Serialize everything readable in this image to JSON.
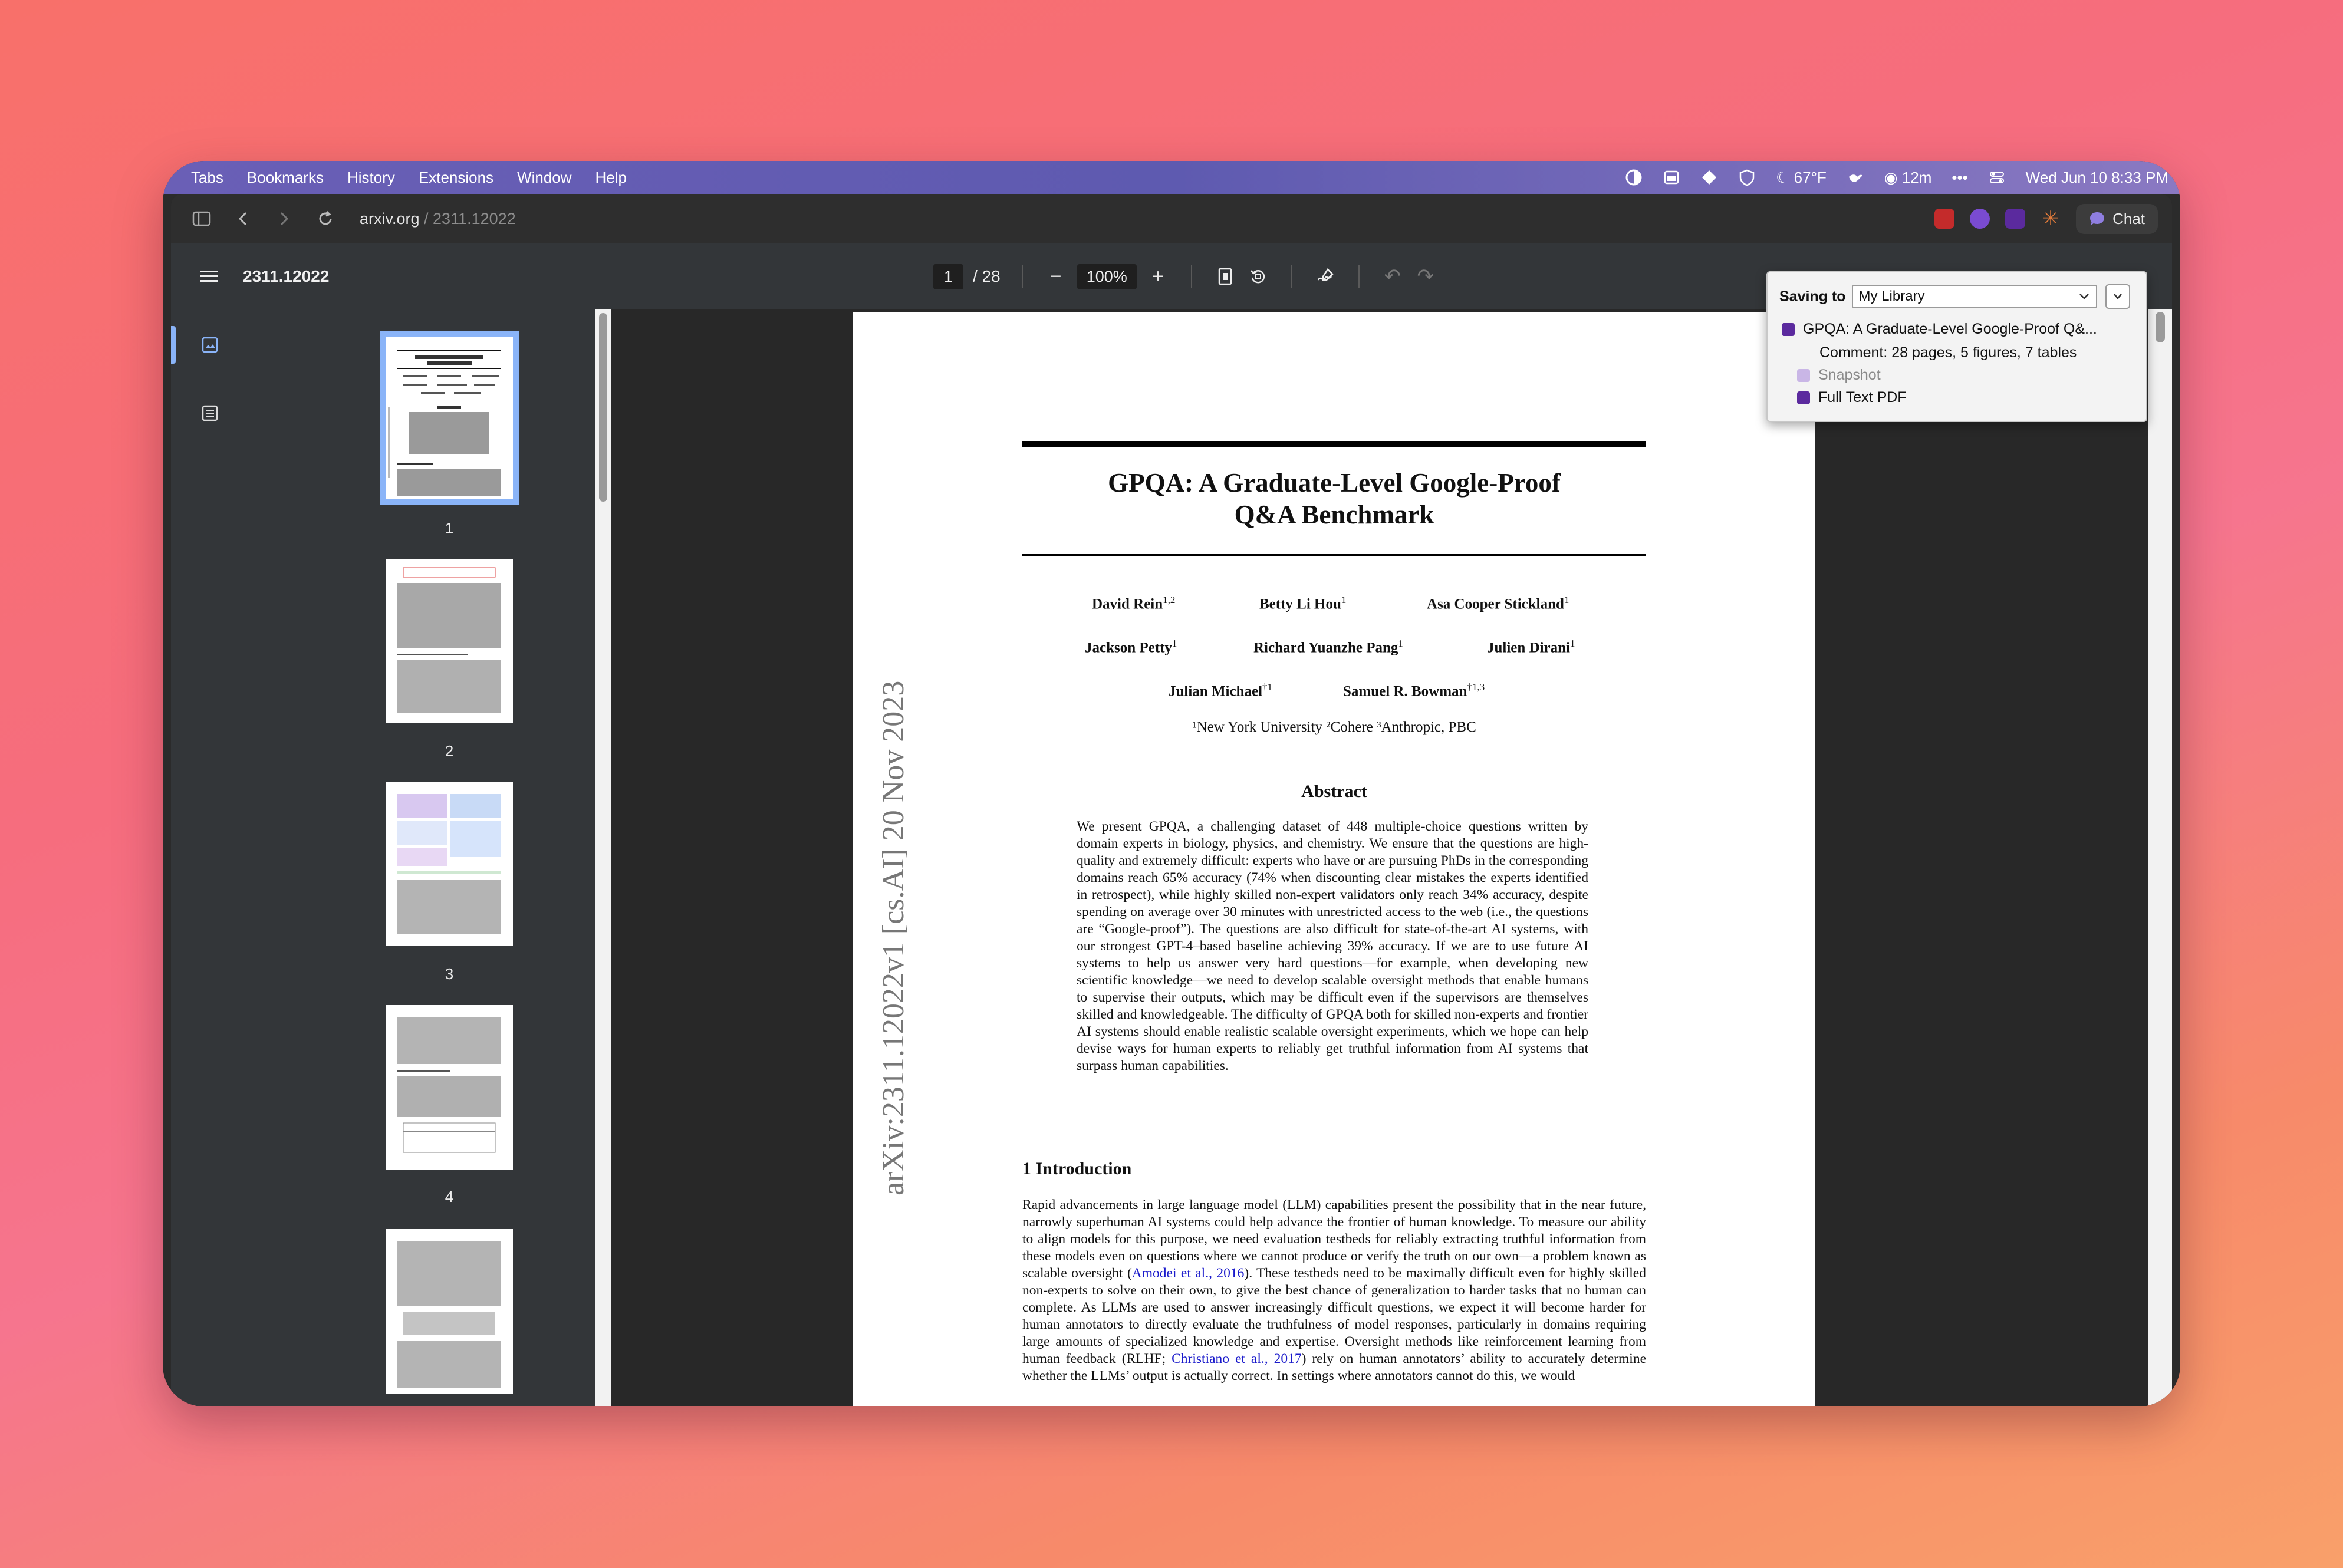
{
  "menubar": {
    "menus": [
      "Tabs",
      "Bookmarks",
      "History",
      "Extensions",
      "Window",
      "Help"
    ],
    "weather": "67°F",
    "timer": "12m",
    "datetime": "Wed Jun 10  8:33 PM"
  },
  "browser": {
    "url_host": "arxiv.org",
    "url_path": " / 2311.12022",
    "chat_label": "Chat"
  },
  "pdf_toolbar": {
    "title": "2311.12022",
    "current_page": "1",
    "total_pages": "/ 28",
    "zoom": "100%"
  },
  "thumbnails": [
    {
      "label": "1"
    },
    {
      "label": "2"
    },
    {
      "label": "3"
    },
    {
      "label": "4"
    }
  ],
  "paper": {
    "arxiv_stamp": "arXiv:2311.12022v1  [cs.AI]  20 Nov 2023",
    "title_line1": "GPQA: A Graduate-Level Google-Proof",
    "title_line2": "Q&A Benchmark",
    "authors": [
      {
        "name": "David Rein",
        "sup": "1,2"
      },
      {
        "name": "Betty Li Hou",
        "sup": "1"
      },
      {
        "name": "Asa Cooper Stickland",
        "sup": "1"
      },
      {
        "name": "Jackson Petty",
        "sup": "1"
      },
      {
        "name": "Richard Yuanzhe Pang",
        "sup": "1"
      },
      {
        "name": "Julien Dirani",
        "sup": "1"
      },
      {
        "name": "Julian Michael",
        "sup": "†1"
      },
      {
        "name": "Samuel R. Bowman",
        "sup": "†1,3"
      }
    ],
    "affiliations": "¹New York University   ²Cohere   ³Anthropic, PBC",
    "abstract_heading": "Abstract",
    "abstract": "We present GPQA, a challenging dataset of 448 multiple-choice questions written by domain experts in biology, physics, and chemistry. We ensure that the questions are high-quality and extremely difficult: experts who have or are pursuing PhDs in the corresponding domains reach 65% accuracy (74% when discounting clear mistakes the experts identified in retrospect), while highly skilled non-expert validators only reach 34% accuracy, despite spending on average over 30 minutes with unrestricted access to the web (i.e., the questions are “Google-proof”). The questions are also difficult for state-of-the-art AI systems, with our strongest GPT-4–based baseline achieving 39% accuracy. If we are to use future AI systems to help us answer very hard questions—for example, when developing new scientific knowledge—we need to develop scalable oversight methods that enable humans to supervise their outputs, which may be difficult even if the supervisors are themselves skilled and knowledgeable. The difficulty of GPQA both for skilled non-experts and frontier AI systems should enable realistic scalable oversight experiments, which we hope can help devise ways for human experts to reliably get truthful information from AI systems that surpass human capabilities.",
    "section_heading": "1    Introduction",
    "intro_part1": "Rapid advancements in large language model (LLM) capabilities present the possibility that in the near future, narrowly superhuman AI systems could help advance the frontier of human knowledge. To measure our ability to align models for this purpose, we need evaluation testbeds for reliably extracting truthful information from these models even on questions where we cannot produce or verify the truth on our own—a problem known as scalable oversight (",
    "intro_cite1": "Amodei et al., 2016",
    "intro_part2": "). These testbeds need to be maximally difficult even for highly skilled non-experts to solve on their own, to give the best chance of generalization to harder tasks that no human can complete. As LLMs are used to answer increasingly difficult questions, we expect it will become harder for human annotators to directly evaluate the truthfulness of model responses, particularly in domains requiring large amounts of specialized knowledge and expertise. Oversight methods like reinforcement learning from human feedback (RLHF; ",
    "intro_cite2": "Christiano et al., 2017",
    "intro_part3": ") rely on human annotators’ ability to accurately determine whether the LLMs’ output is actually correct. In settings where annotators cannot do this, we would"
  },
  "save_popup": {
    "label": "Saving to",
    "library": "My Library",
    "item_title": "GPQA: A Graduate-Level Google-Proof Q&...",
    "comment": "Comment: 28 pages, 5 figures, 7 tables",
    "snapshot": "Snapshot",
    "full_text": "Full Text PDF"
  },
  "colors": {
    "accent_blue": "#8ab4f8",
    "zotero_purple": "#5b2a9e",
    "link_blue": "#1a1acb"
  }
}
